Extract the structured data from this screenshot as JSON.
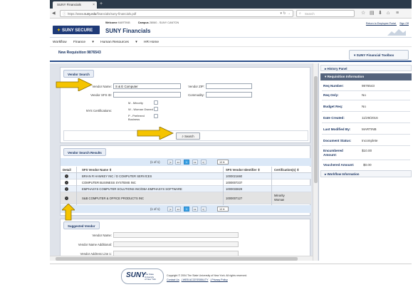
{
  "browser": {
    "tab_title": "SUNY Financials",
    "url_prefix": "https://www.",
    "url_domain": "suny.edu",
    "url_suffix": "/financials/suny-financials.pdf",
    "search_placeholder": "Search"
  },
  "header": {
    "logo_text": "SUNY SECURE",
    "welcome_label": "Welcome",
    "welcome_user": "MARTINB",
    "campus_label": "Campus",
    "campus_value": "28060 - SUNY CANTON",
    "app_title": "SUNY Financials",
    "link_portal": "Return to Employee Portal",
    "link_signoff": "Sign Off"
  },
  "menu": {
    "workflow": "Workflow",
    "finance": "Finance",
    "hr": "Human Resources",
    "hr_home": "HR Home"
  },
  "page": {
    "title": "New Requisition 9876543",
    "toolbox": "SUNY Financial Toolbox"
  },
  "vendor_search": {
    "tab": "Vendor Search",
    "vendor_name_label": "Vendor Name:",
    "vendor_name_value": "S & E Computer",
    "vendor_zip_label": "Vendor ZIP:",
    "vendor_sfs_label": "Vendor SFS ID:",
    "commodity_label": "Commodity:",
    "nys_cert_label": "NYS Certifications:",
    "cert_m": "M - Minority",
    "cert_w": "W - Woman Owned",
    "cert_p1": "P - Preferred",
    "cert_p2": "Business",
    "search_button": "Search"
  },
  "results": {
    "tab": "Vendor Search Results",
    "pager_text": "(1 of 1)",
    "page_num": "1",
    "page_size": "10",
    "columns": {
      "detail": "Detail",
      "vendor_name": "SFS Vendor Name",
      "vendor_id": "SFS Vendor Identifier",
      "cert": "Certification(s)"
    },
    "rows": [
      {
        "name": "BRIAN R HAWKEY INC / D COMPUTER SERVICES",
        "id": "1000021660",
        "cert": ""
      },
      {
        "name": "COMPUTER BUSINESS SYSTEMS INC",
        "id": "1000007237",
        "cert": ""
      },
      {
        "name": "EMPHASYS COMPUTER SOLUTIONS INC/DBA EMPHASYS SOFTWARE",
        "id": "1000033829",
        "cert": ""
      },
      {
        "name": "S&B COMPUTER & OFFICE PRODUCTS INC",
        "id": "1000007127",
        "cert1": "Minority",
        "cert2": "Woman"
      }
    ]
  },
  "suggested": {
    "tab": "Suggested Vendor",
    "name_label": "Vendor Name:",
    "name_add_label": "Vendor Name Additional:",
    "addr1_label": "Vendor Address Line 1:"
  },
  "side": {
    "history": "History Panel",
    "req_info": "Requisition Information",
    "fields": [
      {
        "k": "Req Number:",
        "v": "9876543"
      },
      {
        "k": "Req Only:",
        "v": "No"
      },
      {
        "k": "Budget Req:",
        "v": "No"
      },
      {
        "k": "Date Created:",
        "v": "11/29/2016"
      },
      {
        "k": "Last Modified By:",
        "v": "MARTINB"
      },
      {
        "k": "Document Status:",
        "v": "Incomplete"
      },
      {
        "k": "Encumbered",
        "k2": "Amount:",
        "v": "$10.00"
      },
      {
        "k": "Vouchered Amount:",
        "v": "$0.00"
      }
    ],
    "workflow_info": "Workflow Information"
  },
  "footer": {
    "suny_mark": "SUNY",
    "state_univ_1": "The State University",
    "state_univ_2": "of New York",
    "copyright": "Copyright © 2004 The State University of New York. All rights reserved.",
    "contact": "Contact Us",
    "web_access": "WEB ACCESSIBILITY",
    "privacy": "Privacy Policy"
  },
  "colors": {
    "arrow_fill": "#f5c400",
    "arrow_stroke": "#8a6d00",
    "brand": "#1b3563"
  }
}
